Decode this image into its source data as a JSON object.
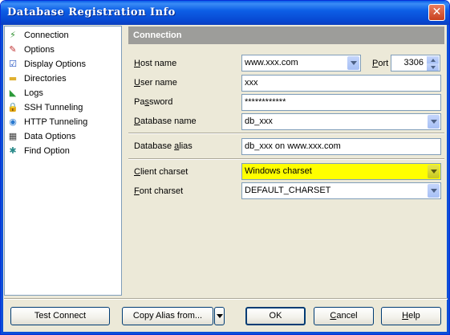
{
  "window": {
    "title": "Database Registration Info",
    "close_label": "✕"
  },
  "nav": {
    "items": [
      {
        "label": "Connection",
        "icon": "connection-icon",
        "glyph": "⚡",
        "color": "#3a8f2c"
      },
      {
        "label": "Options",
        "icon": "options-icon",
        "glyph": "✎",
        "color": "#c03030"
      },
      {
        "label": "Display Options",
        "icon": "display-options-icon",
        "glyph": "☑",
        "color": "#2050c0"
      },
      {
        "label": "Directories",
        "icon": "folder-icon",
        "glyph": "▬",
        "color": "#e0b030"
      },
      {
        "label": "Logs",
        "icon": "logs-icon",
        "glyph": "◣",
        "color": "#2c9a3a"
      },
      {
        "label": "SSH Tunneling",
        "icon": "ssh-tunneling-icon",
        "glyph": "🔒",
        "color": "#d0a020"
      },
      {
        "label": "HTTP Tunneling",
        "icon": "http-tunneling-icon",
        "glyph": "◉",
        "color": "#2a7ad0"
      },
      {
        "label": "Data Options",
        "icon": "data-options-icon",
        "glyph": "▦",
        "color": "#404040"
      },
      {
        "label": "Find Option",
        "icon": "find-option-icon",
        "glyph": "✱",
        "color": "#2a8a8a"
      }
    ]
  },
  "section": {
    "title": "Connection"
  },
  "fields": {
    "host_name": {
      "label_pre": "",
      "label_accel": "H",
      "label_post": "ost name",
      "value": "www.xxx.com"
    },
    "port": {
      "label_pre": "",
      "label_accel": "P",
      "label_post": "ort",
      "value": "3306"
    },
    "user_name": {
      "label_pre": "",
      "label_accel": "U",
      "label_post": "ser name",
      "value": "xxx"
    },
    "password": {
      "label_pre": "Pa",
      "label_accel": "s",
      "label_post": "sword",
      "value": "************"
    },
    "database_name": {
      "label_pre": "",
      "label_accel": "D",
      "label_post": "atabase name",
      "value": "db_xxx"
    },
    "database_alias": {
      "label_pre": "Database ",
      "label_accel": "a",
      "label_post": "lias",
      "value": "db_xxx on www.xxx.com"
    },
    "client_charset": {
      "label_pre": "",
      "label_accel": "C",
      "label_post": "lient charset",
      "value": "Windows charset"
    },
    "font_charset": {
      "label_pre": "",
      "label_accel": "F",
      "label_post": "ont charset",
      "value": "DEFAULT_CHARSET"
    }
  },
  "buttons": {
    "test_connect": "Test Connect",
    "copy_alias": "Copy Alias from...",
    "ok": "OK",
    "cancel_accel": "C",
    "cancel_rest": "ancel",
    "help_accel": "H",
    "help_rest": "elp"
  },
  "colors": {
    "highlight": "#ffff00",
    "selection_border": "#7f9db9",
    "title_bar": "#0a5ee8"
  }
}
